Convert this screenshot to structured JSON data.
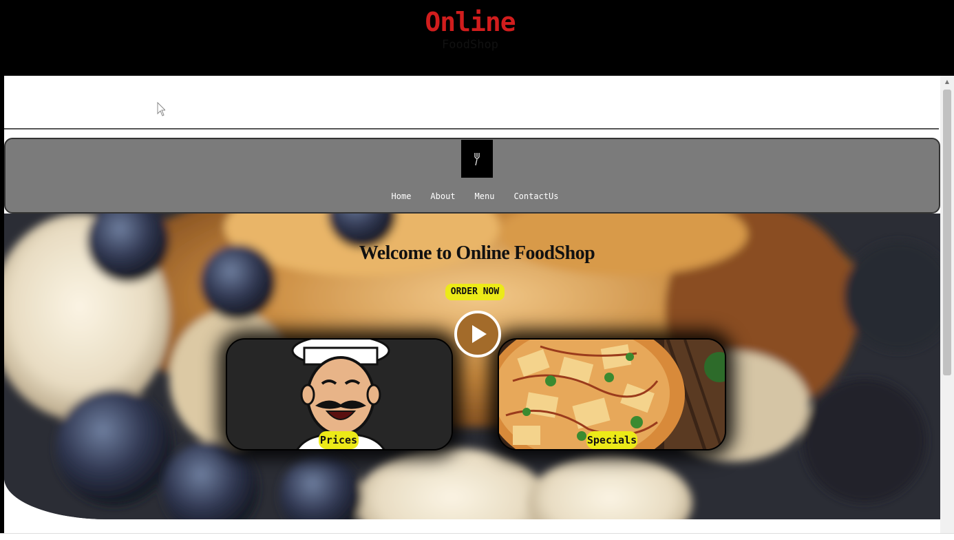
{
  "header": {
    "brand_top": "Online",
    "brand_bottom": "FoodShop"
  },
  "nav": {
    "logo_icon": "food-logo-icon",
    "items": [
      {
        "label": "Home"
      },
      {
        "label": "About"
      },
      {
        "label": "Menu"
      },
      {
        "label": "ContactUs"
      }
    ]
  },
  "hero": {
    "title": "Welcome to Online FoodShop",
    "order_button": "ORDER NOW",
    "play_icon": "play-icon"
  },
  "cards": {
    "prices_label": "Prices",
    "specials_label": "Specials"
  },
  "colors": {
    "brand_red": "#d11d1d",
    "accent_yellow": "#ecea18",
    "nav_gray": "#7b7b7b"
  }
}
